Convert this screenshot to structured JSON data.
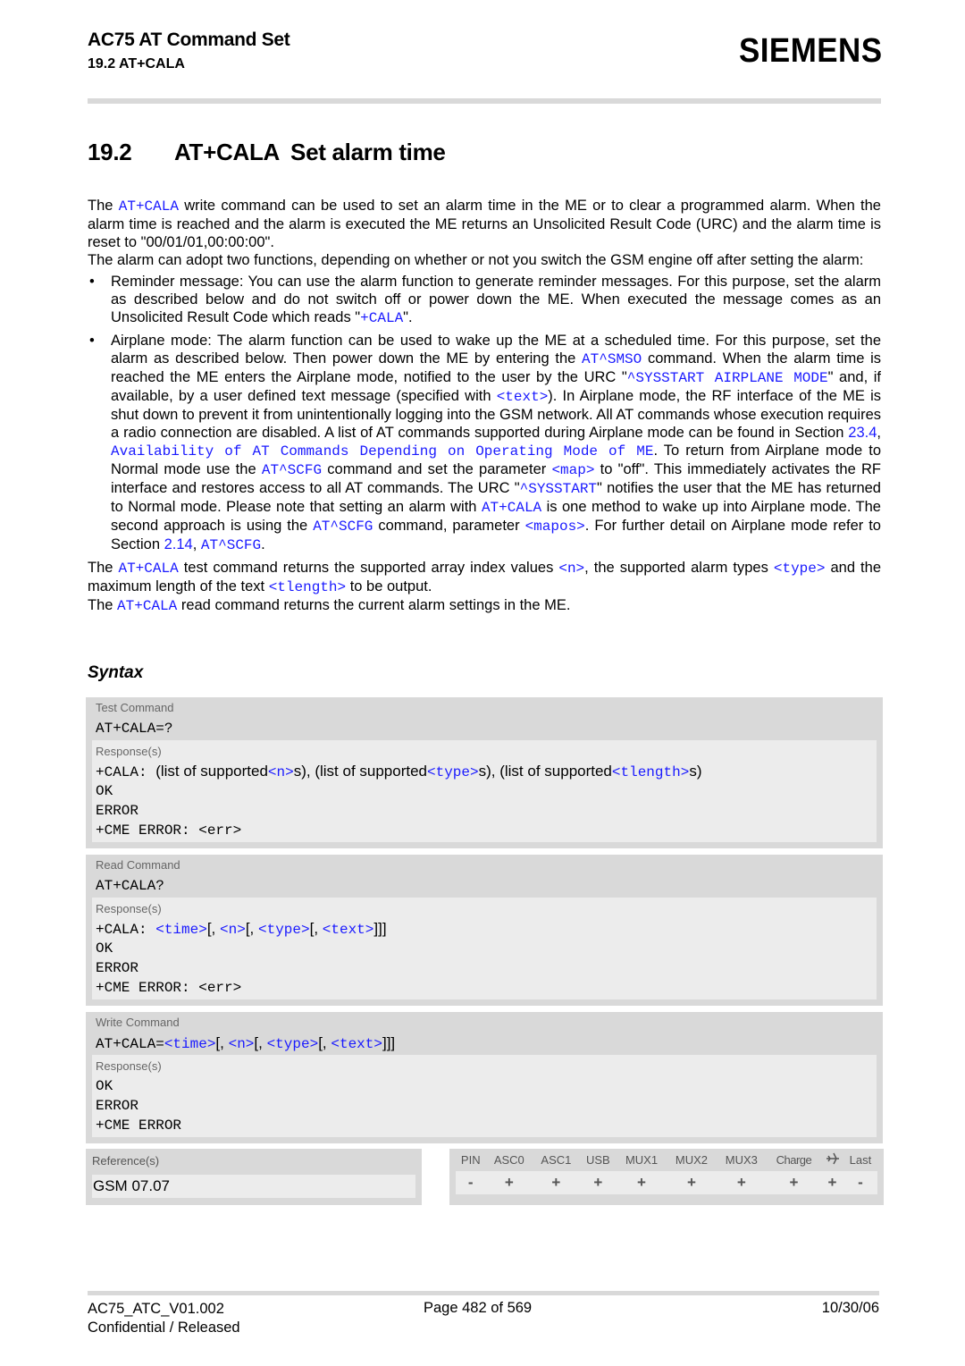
{
  "header": {
    "doc_title": "AC75 AT Command Set",
    "section_ref": "19.2 AT+CALA",
    "logo": "SIEMENS"
  },
  "section": {
    "number": "19.2",
    "command": "AT+CALA",
    "title": "Set alarm time"
  },
  "intro": {
    "p1_a": "The ",
    "p1_cmd": "AT+CALA",
    "p1_b": " write command can be used to set an alarm time in the ME or to clear a programmed alarm. When the alarm time is reached and the alarm is executed the ME returns an Unsolicited Result Code (URC) and the alarm time is reset to \"00/01/01,00:00:00\".",
    "p2": "The alarm can adopt two functions, depending on whether or not you switch the GSM engine off after setting the alarm:"
  },
  "bullets": {
    "reminder": {
      "a": "Reminder message: You can use the alarm function to generate reminder messages. For this purpose, set the alarm as described below and do not switch off or power down the ME. When executed the message comes as an Unsolicited Result Code which reads \"",
      "urc": "+CALA",
      "b": "\"."
    },
    "airplane": {
      "a": "Airplane mode: The alarm function can be used to wake up the ME at a scheduled time. For this purpose, set the alarm as described below. Then power down the ME by entering the ",
      "smso": "AT^SMSO",
      "b": " command. When the alarm time is reached the ME enters the Airplane mode, notified to the user by the URC \"",
      "urc_airplane": "^SYSSTART AIRPLANE MODE",
      "c": "\" and, if available, by a user defined text message (specified with ",
      "text_param": "<text>",
      "d": "). In Airplane mode, the RF interface of the ME is shut down to prevent it from unintentionally logging into the GSM network. All AT commands whose execution requires a radio connection are disabled. A list of AT commands supported during Airplane mode can be found in Section ",
      "sec_23_4": "23.4",
      "e": ", ",
      "sec_23_4_title": "Availability of AT Commands Depending on Operating Mode of ME",
      "f": ". To return from Airplane mode to Normal mode use the ",
      "scfg1": "AT^SCFG",
      "g": " command and set the parameter ",
      "map_param": "<map>",
      "h": " to \"off\". This immediately activates the RF interface and restores access to all AT commands. The URC \"",
      "urc_sysstart": "^SYSSTART",
      "i": "\" notifies the user that the ME has returned to Normal mode. Please note that setting an alarm with ",
      "cala": "AT+CALA",
      "j": " is one method to wake up into Airplane mode. The second approach is using the ",
      "scfg2": "AT^SCFG",
      "k": " command, parameter ",
      "mapos_param": "<mapos>",
      "l": ". For further detail on Airplane mode refer to Section ",
      "sec_2_14": "2.14",
      "m": ", ",
      "scfg3": "AT^SCFG",
      "n": "."
    }
  },
  "outro": {
    "p1_a": "The ",
    "p1_cmd": "AT+CALA",
    "p1_b": " test command returns the supported array index values ",
    "p1_n": "<n>",
    "p1_c": ", the supported alarm types ",
    "p1_type": "<type>",
    "p1_d": " and the maximum length of the text ",
    "p1_tlength": "<tlength>",
    "p1_e": " to be output.",
    "p2_a": "The ",
    "p2_cmd": "AT+CALA",
    "p2_b": " read command returns the current alarm settings in the ME."
  },
  "syntax": {
    "heading": "Syntax",
    "responses_label": "Response(s)",
    "test": {
      "label": "Test Command",
      "command": "AT+CALA=?",
      "resp_prefix": "+CALA: ",
      "resp_t1": "(list of supported",
      "resp_n": "<n>",
      "resp_t2": "s), (list of supported",
      "resp_type": "<type>",
      "resp_t3": "s), (list of supported",
      "resp_tlength": "<tlength>",
      "resp_t4": "s)",
      "lines": [
        "OK",
        "ERROR",
        "+CME ERROR: <err>"
      ]
    },
    "read": {
      "label": "Read Command",
      "command": "AT+CALA?",
      "resp_prefix": "+CALA: ",
      "time": "<time>",
      "n": "<n>",
      "type": "<type>",
      "text": "<text>",
      "sep": "[, ",
      "close": "]]]",
      "lines": [
        "OK",
        "ERROR",
        "+CME ERROR: <err>"
      ]
    },
    "write": {
      "label": "Write Command",
      "command_prefix": "AT+CALA=",
      "time": "<time>",
      "n": "<n>",
      "type": "<type>",
      "text": "<text>",
      "sep": "[, ",
      "close": "]]]",
      "lines": [
        "OK",
        "ERROR",
        "+CME ERROR"
      ]
    }
  },
  "reference": {
    "label": "Reference(s)",
    "value": "GSM 07.07"
  },
  "interfaces": {
    "columns": [
      "PIN",
      "ASC0",
      "ASC1",
      "USB",
      "MUX1",
      "MUX2",
      "MUX3",
      "Charge",
      "airplane-icon",
      "Last"
    ],
    "values": [
      "-",
      "+",
      "+",
      "+",
      "+",
      "+",
      "+",
      "+",
      "+",
      "-"
    ]
  },
  "footer": {
    "doc_id": "AC75_ATC_V01.002",
    "status": "Confidential / Released",
    "page": "Page 482 of 569",
    "date": "10/30/06"
  },
  "colors": {
    "link": "#1a1aff",
    "box_dark": "#d9d9d9",
    "box_light": "#ececec"
  }
}
